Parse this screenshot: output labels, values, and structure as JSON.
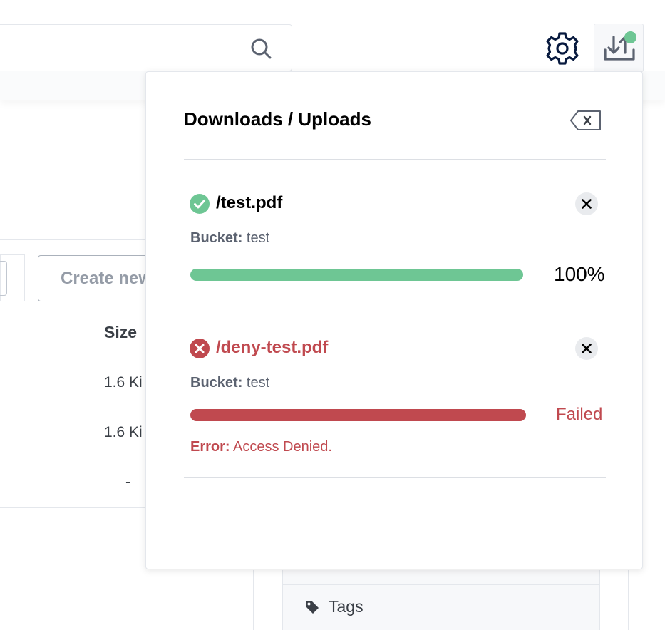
{
  "background": {
    "create_button_label": "Create new",
    "size_header": "Size",
    "rows": [
      {
        "size": "1.6 Ki"
      },
      {
        "size": "1.6 Ki"
      },
      {
        "size": "-"
      }
    ],
    "tags_label": "Tags"
  },
  "transfers": {
    "title": "Downloads / Uploads",
    "bucket_label": "Bucket:",
    "items": [
      {
        "name": "/test.pdf",
        "status": "success",
        "bucket": "test",
        "progress_percent": 100,
        "progress_text": "100%",
        "color": "#6ec694"
      },
      {
        "name": "/deny-test.pdf",
        "status": "failed",
        "bucket": "test",
        "progress_percent": 100,
        "progress_text": "Failed",
        "error_label": "Error:",
        "error_message": "Access Denied.",
        "color": "#c0494f"
      }
    ]
  },
  "icons": {
    "search": "search-icon",
    "settings": "gear-icon",
    "transfers": "upload-download-icon",
    "clear_all": "backspace-icon",
    "close": "close-icon",
    "success": "check-circle-icon",
    "failed": "x-circle-icon",
    "tag": "tag-icon"
  },
  "colors": {
    "success": "#6ec694",
    "error": "#c0494f",
    "notification_dot": "#6ec694"
  }
}
